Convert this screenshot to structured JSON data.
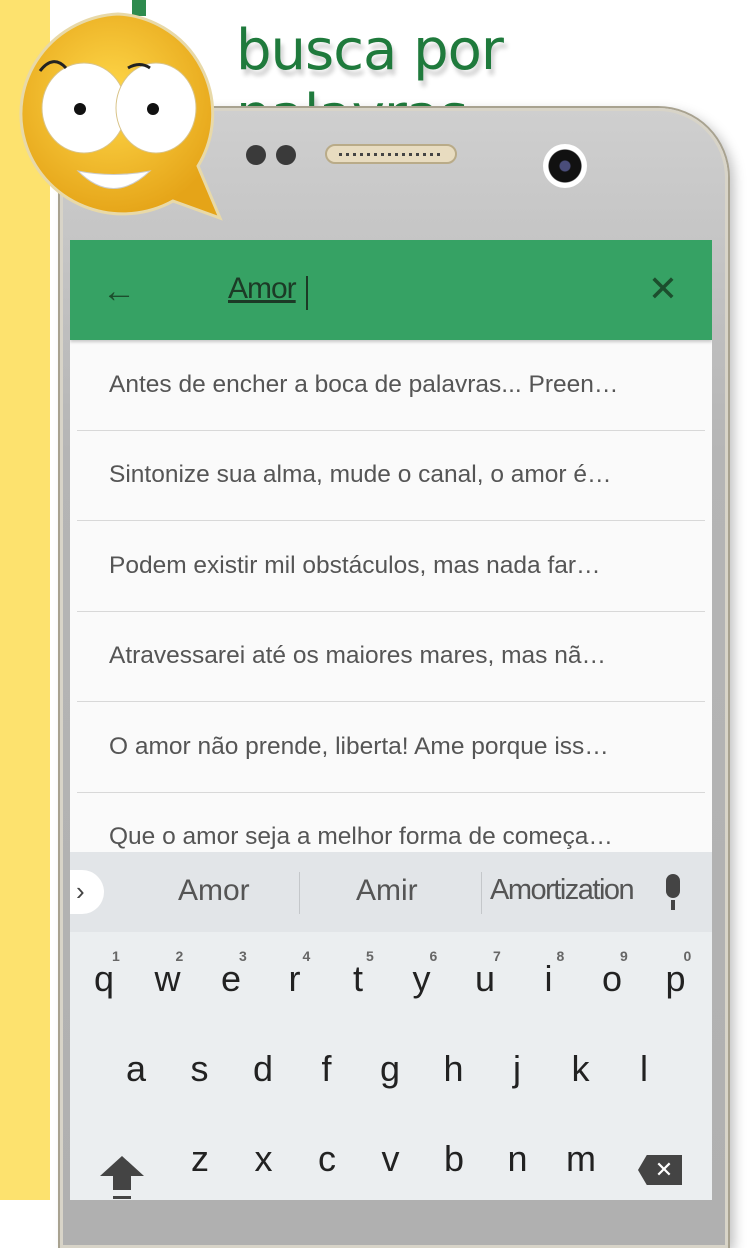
{
  "promo": {
    "headline": "busca por palavras"
  },
  "search": {
    "query": "Amor",
    "back_icon": "arrow-left-icon",
    "clear_icon": "close-icon",
    "accent": "#36a264"
  },
  "results": [
    "Antes de encher a boca de palavras... Preen…",
    "Sintonize sua alma, mude o canal, o amor é…",
    "Podem existir mil obstáculos, mas nada far…",
    "Atravessarei até os maiores mares, mas nã…",
    "O amor não prende, liberta! Ame porque iss…",
    "Que o amor seja a melhor forma de começa…"
  ],
  "keyboard": {
    "suggestions": [
      "Amor",
      "Amir",
      "Amortization"
    ],
    "row1": [
      "q",
      "w",
      "e",
      "r",
      "t",
      "y",
      "u",
      "i",
      "o",
      "p"
    ],
    "row1_nums": [
      "1",
      "2",
      "3",
      "4",
      "5",
      "6",
      "7",
      "8",
      "9",
      "0"
    ],
    "row2": [
      "a",
      "s",
      "d",
      "f",
      "g",
      "h",
      "j",
      "k",
      "l"
    ],
    "row3": [
      "z",
      "x",
      "c",
      "v",
      "b",
      "n",
      "m"
    ],
    "delete_glyph": "✕"
  }
}
